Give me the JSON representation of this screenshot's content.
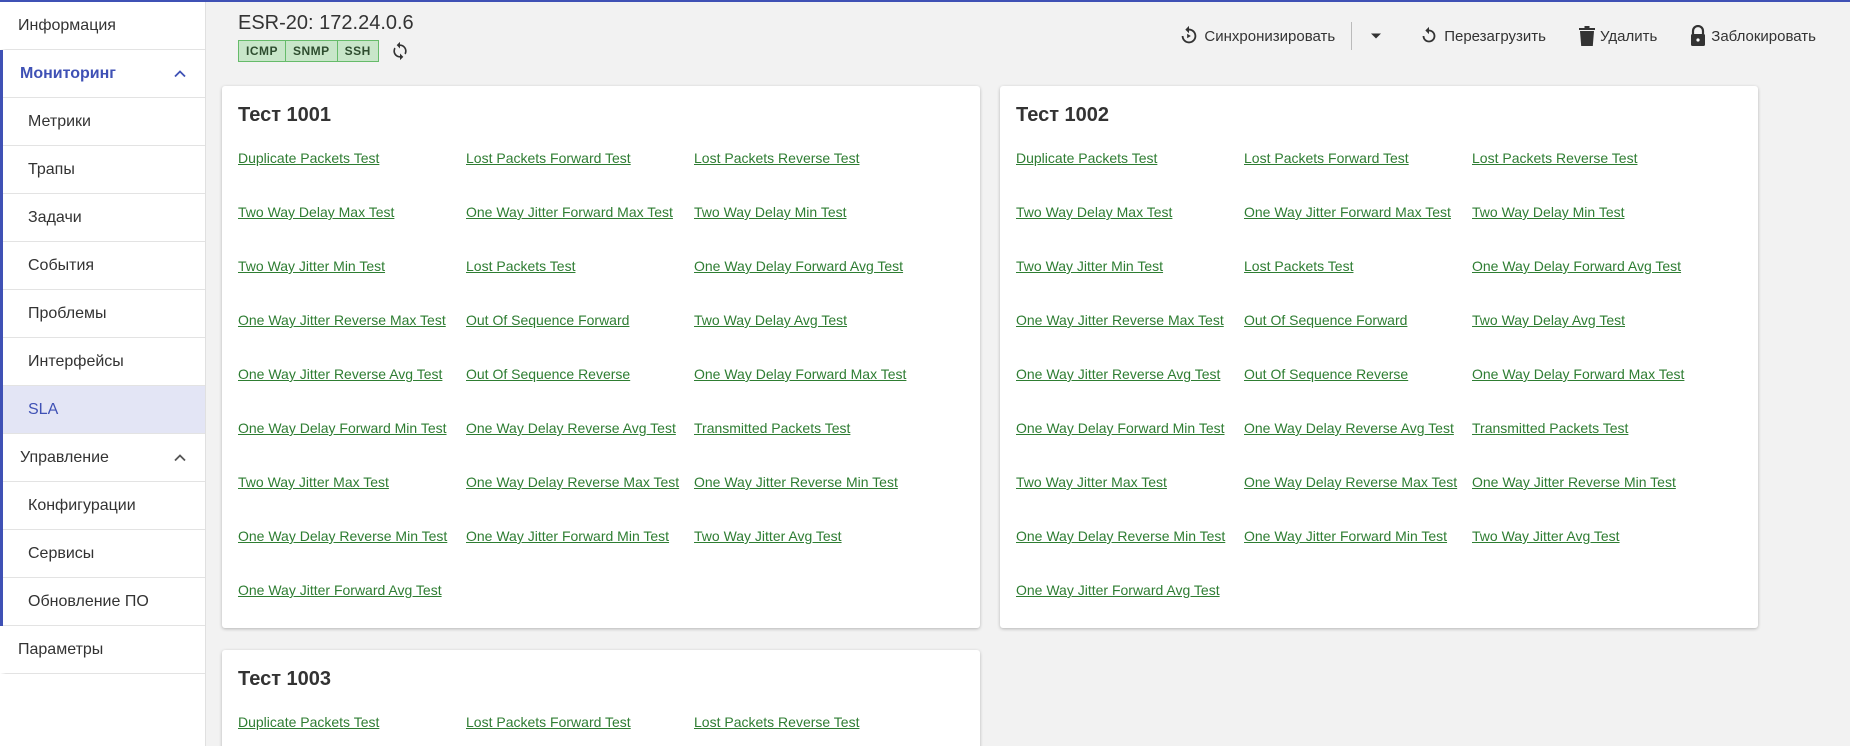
{
  "sidebar": {
    "info": "Информация",
    "monitoring": {
      "label": "Мониторинг",
      "items": [
        "Метрики",
        "Трапы",
        "Задачи",
        "События",
        "Проблемы",
        "Интерфейсы",
        "SLA"
      ]
    },
    "management": {
      "label": "Управление",
      "items": [
        "Конфигурации",
        "Сервисы",
        "Обновление ПО"
      ]
    },
    "params": "Параметры"
  },
  "header": {
    "title": "ESR-20: 172.24.0.6",
    "badges": [
      "ICMP",
      "SNMP",
      "SSH"
    ],
    "sync_label": "Синхронизировать",
    "reboot_label": "Перезагрузить",
    "delete_label": "Удалить",
    "lock_label": "Заблокировать"
  },
  "colors": {
    "accent": "#3f51b5",
    "link": "#2e7d32",
    "badge_bg": "#c8e6c9",
    "selected_bg": "#e3e5f5"
  },
  "cards": [
    {
      "title": "Тест 1001",
      "rows": [
        [
          "Duplicate Packets Test",
          "Lost Packets Forward Test",
          "Lost Packets Reverse Test"
        ],
        [
          "Two Way Delay Max Test",
          "One Way Jitter Forward Max Test",
          "Two Way Delay Min Test"
        ],
        [
          "Two Way Jitter Min Test",
          "Lost Packets Test",
          "One Way Delay Forward Avg Test"
        ],
        [
          "One Way Jitter Reverse Max Test",
          "Out Of Sequence Forward",
          "Two Way Delay Avg Test"
        ],
        [
          "One Way Jitter Reverse Avg Test",
          "Out Of Sequence Reverse",
          "One Way Delay Forward Max Test"
        ],
        [
          "One Way Delay Forward Min Test",
          "One Way Delay Reverse Avg Test",
          "Transmitted Packets Test"
        ],
        [
          "Two Way Jitter Max Test",
          "One Way Delay Reverse Max Test",
          "One Way Jitter Reverse Min Test"
        ],
        [
          "One Way Delay Reverse Min Test",
          "One Way Jitter Forward Min Test",
          "Two Way Jitter Avg Test"
        ],
        [
          "One Way Jitter Forward Avg Test"
        ]
      ]
    },
    {
      "title": "Тест 1002",
      "rows": [
        [
          "Duplicate Packets Test",
          "Lost Packets Forward Test",
          "Lost Packets Reverse Test"
        ],
        [
          "Two Way Delay Max Test",
          "One Way Jitter Forward Max Test",
          "Two Way Delay Min Test"
        ],
        [
          "Two Way Jitter Min Test",
          "Lost Packets Test",
          "One Way Delay Forward Avg Test"
        ],
        [
          "One Way Jitter Reverse Max Test",
          "Out Of Sequence Forward",
          "Two Way Delay Avg Test"
        ],
        [
          "One Way Jitter Reverse Avg Test",
          "Out Of Sequence Reverse",
          "One Way Delay Forward Max Test"
        ],
        [
          "One Way Delay Forward Min Test",
          "One Way Delay Reverse Avg Test",
          "Transmitted Packets Test"
        ],
        [
          "Two Way Jitter Max Test",
          "One Way Delay Reverse Max Test",
          "One Way Jitter Reverse Min Test"
        ],
        [
          "One Way Delay Reverse Min Test",
          "One Way Jitter Forward Min Test",
          "Two Way Jitter Avg Test"
        ],
        [
          "One Way Jitter Forward Avg Test"
        ]
      ]
    },
    {
      "title": "Тест 1003",
      "rows": [
        [
          "Duplicate Packets Test",
          "Lost Packets Forward Test",
          "Lost Packets Reverse Test"
        ]
      ]
    }
  ]
}
